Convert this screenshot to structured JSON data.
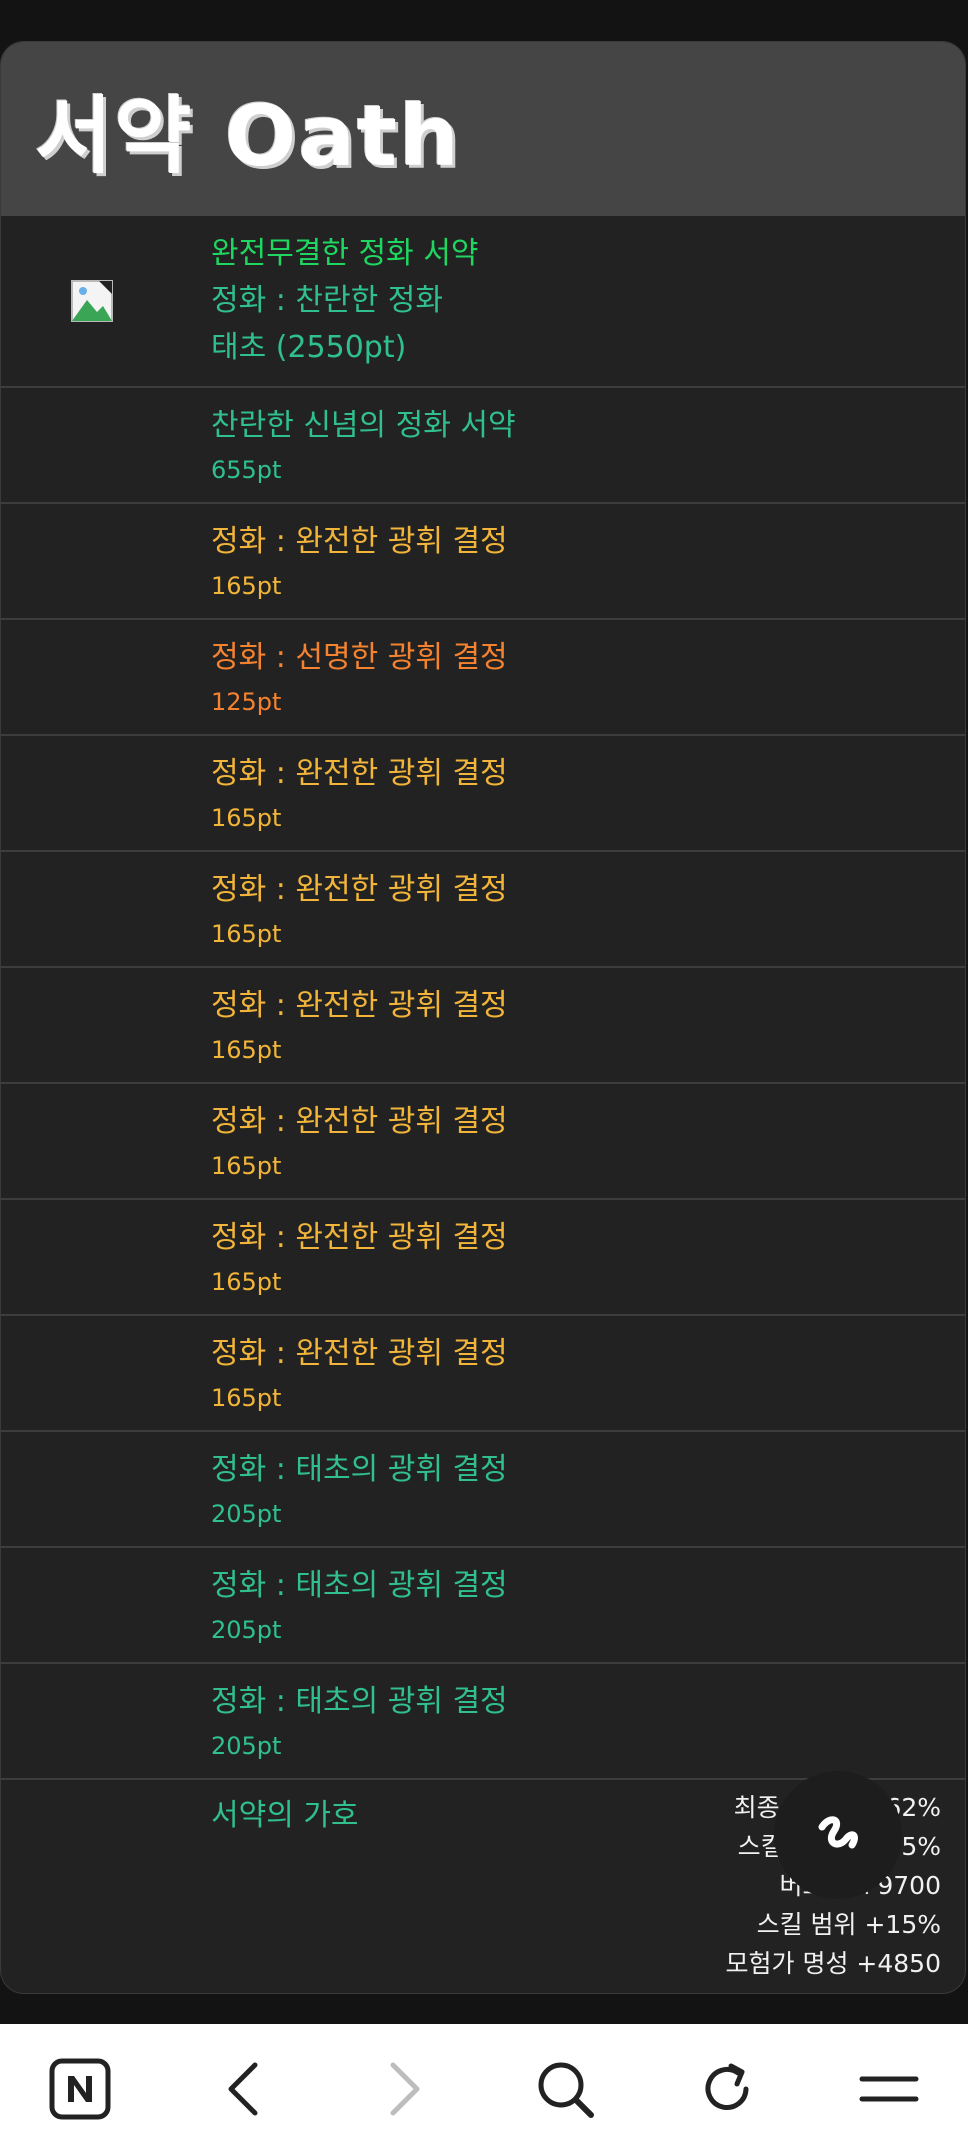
{
  "header": {
    "title": "서약 Oath"
  },
  "first_row": {
    "line1": "완전무결한 정화 서약",
    "line2": "정화 : 찬란한 정화",
    "line3": "태초 (2550pt)"
  },
  "items": [
    {
      "name": "찬란한 신념의 정화 서약",
      "pt": "655pt",
      "color": "green"
    },
    {
      "name": "정화 : 완전한 광휘 결정",
      "pt": "165pt",
      "color": "gold"
    },
    {
      "name": "정화 : 선명한 광휘 결정",
      "pt": "125pt",
      "color": "orange"
    },
    {
      "name": "정화 : 완전한 광휘 결정",
      "pt": "165pt",
      "color": "gold"
    },
    {
      "name": "정화 : 완전한 광휘 결정",
      "pt": "165pt",
      "color": "gold"
    },
    {
      "name": "정화 : 완전한 광휘 결정",
      "pt": "165pt",
      "color": "gold"
    },
    {
      "name": "정화 : 완전한 광휘 결정",
      "pt": "165pt",
      "color": "gold"
    },
    {
      "name": "정화 : 완전한 광휘 결정",
      "pt": "165pt",
      "color": "gold"
    },
    {
      "name": "정화 : 완전한 광휘 결정",
      "pt": "165pt",
      "color": "gold"
    },
    {
      "name": "정화 : 태초의 광휘 결정",
      "pt": "205pt",
      "color": "green"
    },
    {
      "name": "정화 : 태초의 광휘 결정",
      "pt": "205pt",
      "color": "green"
    },
    {
      "name": "정화 : 태초의 광휘 결정",
      "pt": "205pt",
      "color": "green"
    }
  ],
  "protection": {
    "label": "서약의 가호",
    "stats": [
      "최종 데미지 +62%",
      "스킬 쿨타임 -3.5%",
      "버프력 +9700",
      "스킬 범위 +15%",
      "모험가 명성 +4850"
    ]
  },
  "colors": {
    "bright_green": "#1ed760",
    "green": "#2fc08d",
    "gold": "#f2b53a",
    "orange": "#f5822f"
  },
  "icons": {
    "broken_image": "broken-image-icon",
    "fab": "squiggle-logo-icon",
    "nav": [
      "naver-n-icon",
      "back-arrow-icon",
      "forward-arrow-icon",
      "search-icon",
      "refresh-icon",
      "menu-icon"
    ]
  }
}
